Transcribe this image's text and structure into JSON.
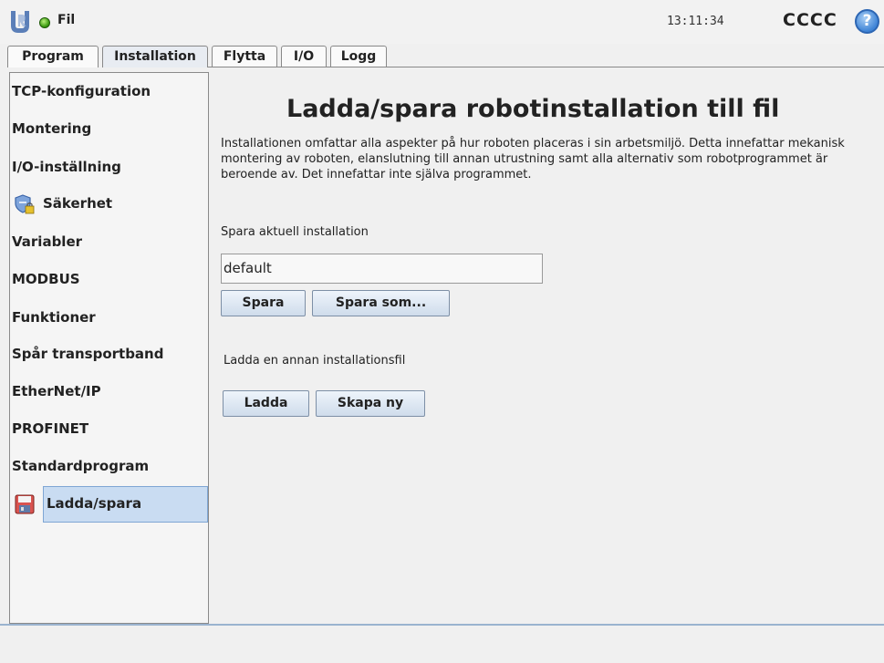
{
  "header": {
    "file_label": "Fil",
    "clock": "13:11:34",
    "robot_name": "CCCC",
    "help_glyph": "?",
    "status_color": "#3a9a10"
  },
  "tabs": [
    {
      "label": "Program",
      "active": false
    },
    {
      "label": "Installation",
      "active": true
    },
    {
      "label": "Flytta",
      "active": false
    },
    {
      "label": "I/O",
      "active": false
    },
    {
      "label": "Logg",
      "active": false
    }
  ],
  "sidebar": {
    "items": [
      {
        "label": "TCP-konfiguration"
      },
      {
        "label": "Montering"
      },
      {
        "label": "I/O-inställning"
      },
      {
        "label": "Säkerhet",
        "icon": "shield-lock-icon"
      },
      {
        "label": "Variabler"
      },
      {
        "label": "MODBUS"
      },
      {
        "label": "Funktioner"
      },
      {
        "label": "Spår transportband"
      },
      {
        "label": "EtherNet/IP"
      },
      {
        "label": "PROFINET"
      },
      {
        "label": "Standardprogram"
      },
      {
        "label": "Ladda/spara",
        "icon": "floppy-disk-icon",
        "selected": true
      }
    ]
  },
  "main": {
    "title": "Ladda/spara robotinstallation till fil",
    "description": "Installationen omfattar alla aspekter på hur roboten placeras i sin arbetsmiljö. Detta innefattar mekanisk montering av roboten, elanslutning till annan utrustning samt alla alternativ som robotprogrammet är beroende av. Det innefattar inte själva programmet.",
    "save_section_label": "Spara aktuell installation",
    "installation_name": "default",
    "save_button": "Spara",
    "save_as_button": "Spara som...",
    "load_section_label": "Ladda en annan installationsfil",
    "load_button": "Ladda",
    "new_button": "Skapa ny"
  }
}
